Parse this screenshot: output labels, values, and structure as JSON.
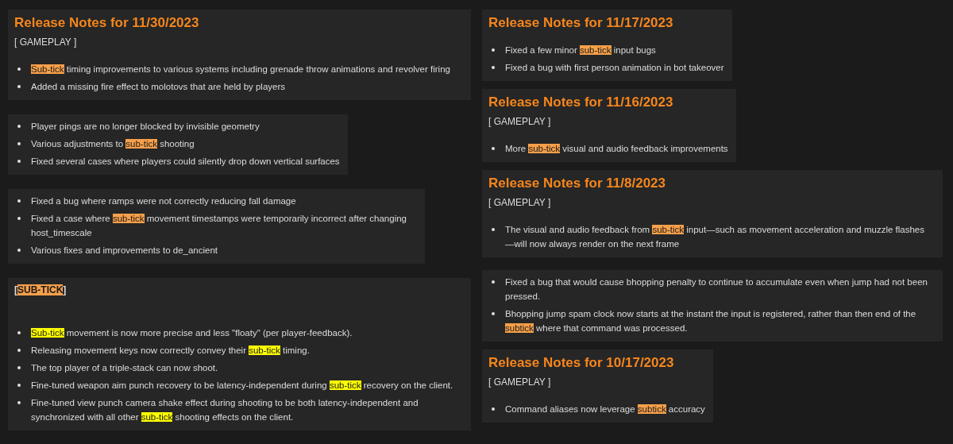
{
  "columns": [
    {
      "cards": [
        {
          "title": "Release Notes for 11/30/2023",
          "label": {
            "bold": false,
            "segments": [
              {
                "text": "[ GAMEPLAY ]"
              }
            ]
          },
          "items": [
            [
              {
                "text": "Sub-tick",
                "color": "#f7a04a"
              },
              {
                "text": " timing improvements to various systems including grenade throw animations and revolver firing"
              }
            ],
            [
              {
                "text": "Added a missing fire effect to molotovs that are held by players"
              }
            ]
          ]
        },
        {
          "items": [
            [
              {
                "text": "Player pings are no longer blocked by invisible geometry"
              }
            ],
            [
              {
                "text": "Various adjustments to "
              },
              {
                "text": "sub-tick",
                "color": "#f7a04a"
              },
              {
                "text": " shooting"
              }
            ],
            [
              {
                "text": "Fixed several cases where players could silently drop down vertical surfaces"
              }
            ]
          ]
        },
        {
          "items": [
            [
              {
                "text": "Fixed a bug where ramps were not correctly reducing fall damage"
              }
            ],
            [
              {
                "text": "Fixed a case where "
              },
              {
                "text": "sub-tick",
                "color": "#f7a04a"
              },
              {
                "text": " movement timestamps were temporarily incorrect after changing host_timescale"
              }
            ],
            [
              {
                "text": "Various fixes and improvements to de_ancient"
              }
            ]
          ]
        },
        {
          "label": {
            "bold": true,
            "segments": [
              {
                "text": "["
              },
              {
                "text": "SUB-TICK",
                "color": "#f7a04a"
              },
              {
                "text": "]"
              }
            ]
          },
          "items": [
            [
              {
                "text": "Sub-tick",
                "color": "#ffff00"
              },
              {
                "text": " movement is now more precise and less \"floaty\" (per player-feedback)."
              }
            ],
            [
              {
                "text": "Releasing movement keys now correctly convey their "
              },
              {
                "text": "sub-tick",
                "color": "#ffff00"
              },
              {
                "text": " timing."
              }
            ],
            [
              {
                "text": "The top player of a triple-stack can now shoot."
              }
            ],
            [
              {
                "text": "Fine-tuned weapon aim punch recovery to be latency-independent during "
              },
              {
                "text": "sub-tick",
                "color": "#ffff00"
              },
              {
                "text": " recovery on the client."
              }
            ],
            [
              {
                "text": "Fine-tuned view punch camera shake effect during shooting to be both latency-independent and synchronized with all other "
              },
              {
                "text": "sub-tick",
                "color": "#ffff00"
              },
              {
                "text": " shooting effects on the client."
              }
            ]
          ]
        }
      ]
    },
    {
      "cards": [
        {
          "title": "Release Notes for 11/17/2023",
          "items": [
            [
              {
                "text": "Fixed a few minor "
              },
              {
                "text": "sub-tick",
                "color": "#f7a04a"
              },
              {
                "text": " input bugs"
              }
            ],
            [
              {
                "text": "Fixed a bug with first person animation in bot takeover"
              }
            ]
          ]
        },
        {
          "title": "Release Notes for 11/16/2023",
          "label": {
            "bold": false,
            "segments": [
              {
                "text": "[ GAMEPLAY ]"
              }
            ]
          },
          "items": [
            [
              {
                "text": "More "
              },
              {
                "text": "sub-tick",
                "color": "#f7a04a"
              },
              {
                "text": " visual and audio feedback improvements"
              }
            ]
          ]
        },
        {
          "title": "Release Notes for 11/8/2023",
          "label": {
            "bold": false,
            "segments": [
              {
                "text": "[ GAMEPLAY ]"
              }
            ]
          },
          "items": [
            [
              {
                "text": "The visual and audio feedback from "
              },
              {
                "text": "sub-tick",
                "color": "#f7a04a"
              },
              {
                "text": " input—such as movement acceleration and muzzle flashes —will now always render on the next frame"
              }
            ]
          ]
        },
        {
          "items": [
            [
              {
                "text": "Fixed a bug that would cause bhopping penalty to continue to accumulate even when jump had not been pressed."
              }
            ],
            [
              {
                "text": "Bhopping jump spam clock now starts at the instant the input is registered, rather than then end of the "
              },
              {
                "text": "subtick",
                "color": "#f7a04a"
              },
              {
                "text": " where that command was processed."
              }
            ]
          ]
        },
        {
          "title": "Release Notes for 10/17/2023",
          "label": {
            "bold": false,
            "segments": [
              {
                "text": "[ GAMEPLAY ]"
              }
            ]
          },
          "items": [
            [
              {
                "text": "Command aliases now leverage "
              },
              {
                "text": "subtick",
                "color": "#f7a04a"
              },
              {
                "text": " accuracy"
              }
            ]
          ]
        }
      ]
    }
  ]
}
